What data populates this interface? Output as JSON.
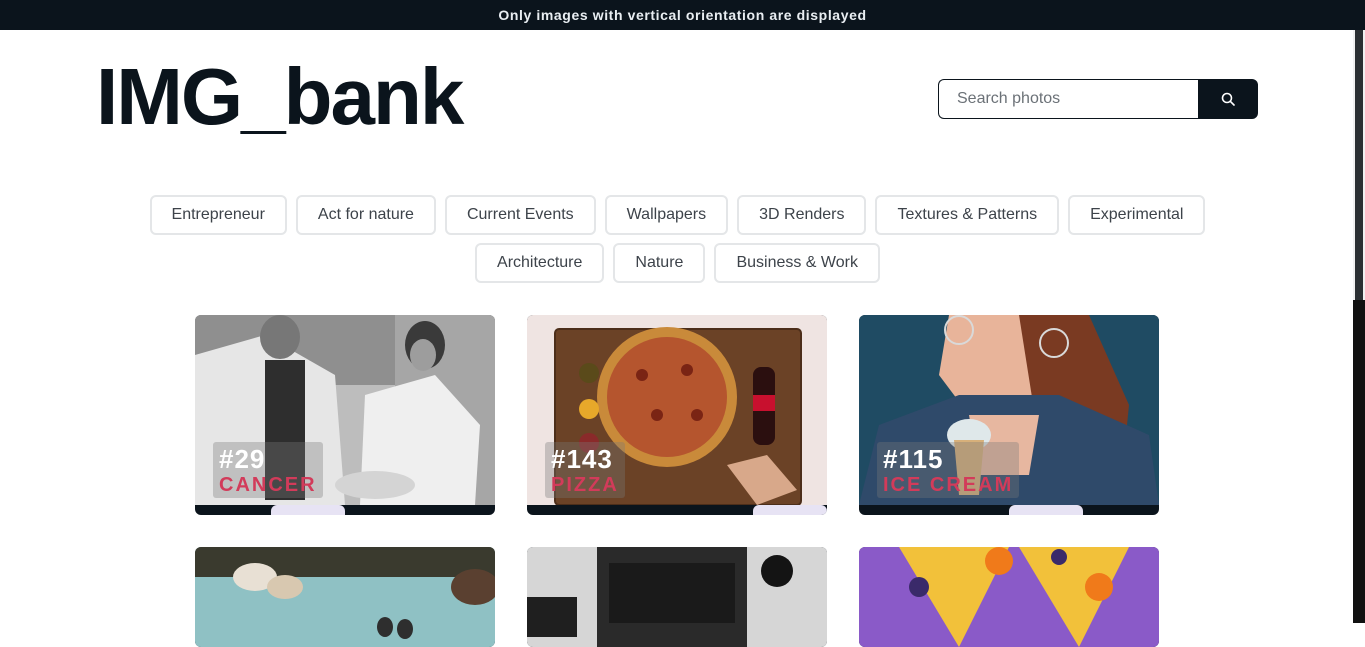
{
  "banner": {
    "text": "Only images with vertical orientation are displayed"
  },
  "header": {
    "logo": "IMG_bank"
  },
  "search": {
    "placeholder": "Search photos",
    "icon": "search-icon"
  },
  "tags": [
    "Entrepreneur",
    "Act for nature",
    "Current Events",
    "Wallpapers",
    "3D Renders",
    "Textures & Patterns",
    "Experimental",
    "Architecture",
    "Nature",
    "Business & Work"
  ],
  "cards": [
    {
      "number": "#29",
      "category": "CANCER"
    },
    {
      "number": "#143",
      "category": "PIZZA"
    },
    {
      "number": "#115",
      "category": "ICE CREAM"
    }
  ],
  "colors": {
    "dark": "#0b141c",
    "accent": "#d23b5a",
    "tag_border": "#e4e6e8"
  }
}
